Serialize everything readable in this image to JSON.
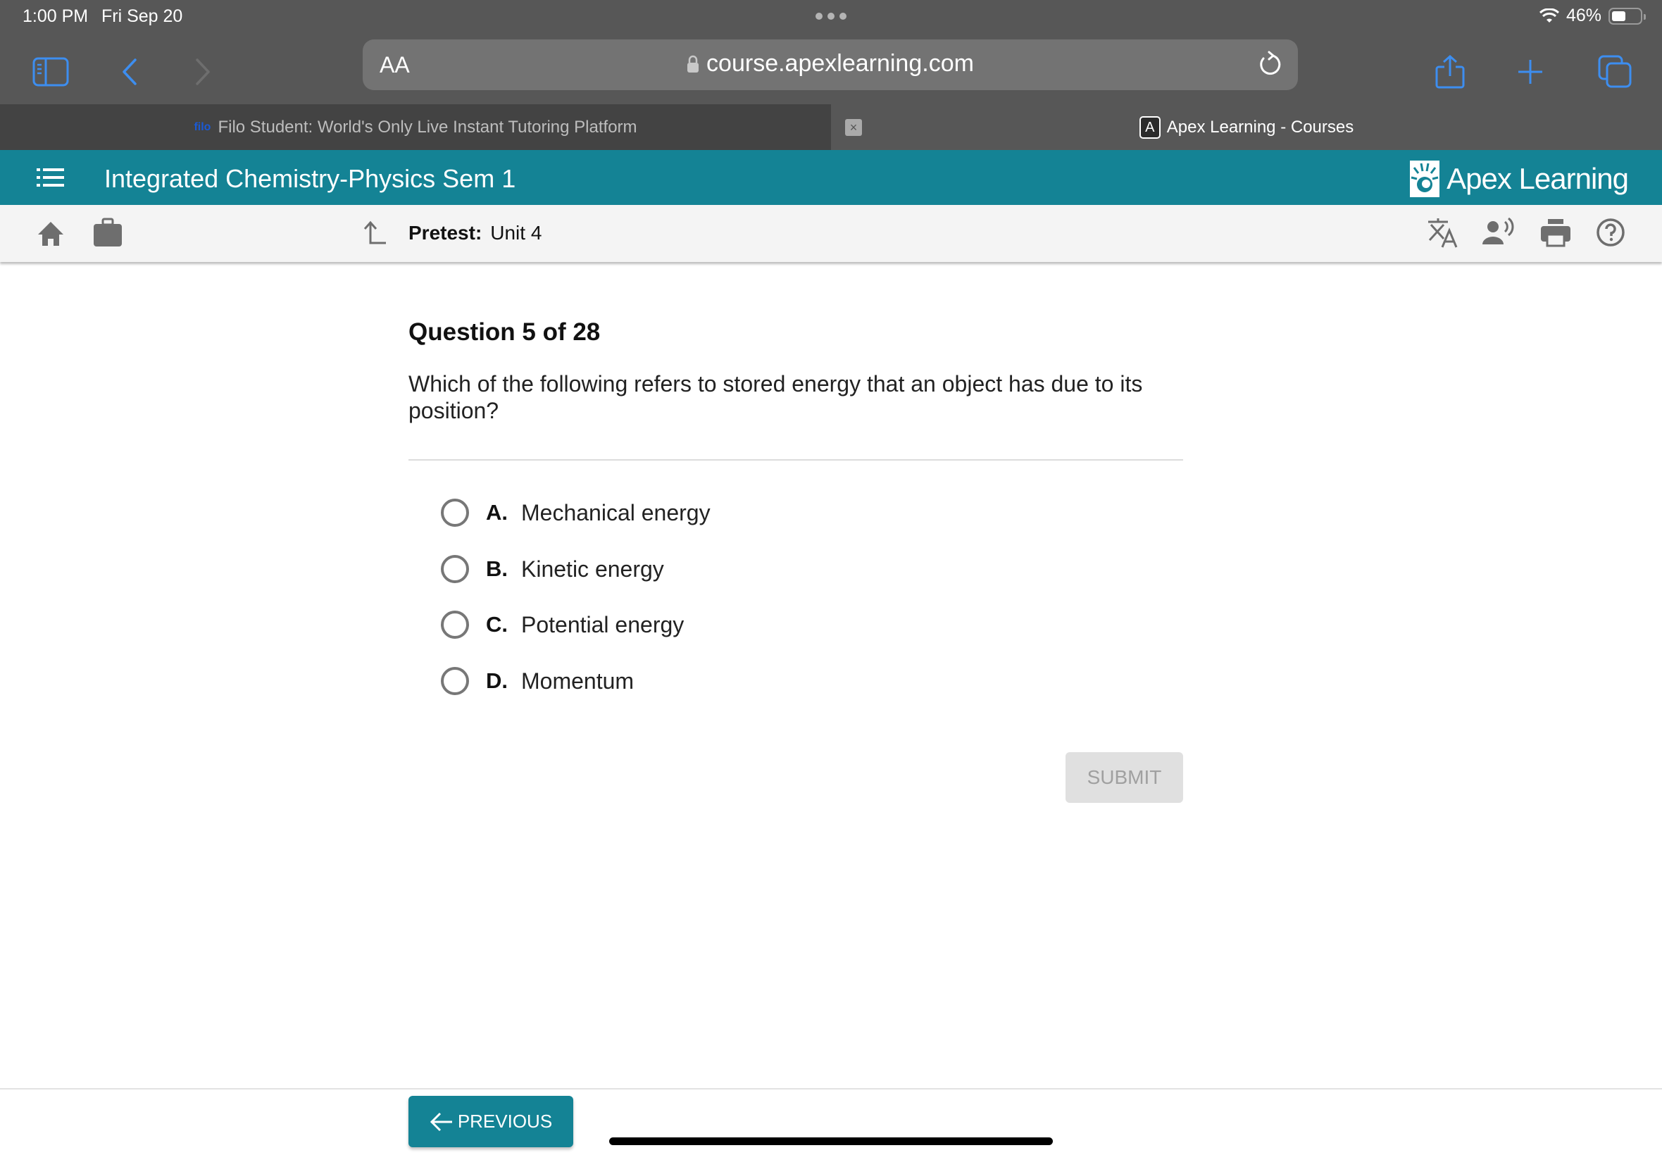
{
  "status_bar": {
    "time": "1:00 PM",
    "date": "Fri Sep 20",
    "battery_percent": "46%",
    "battery_level": 0.46
  },
  "browser": {
    "url_aa_label": "AA",
    "url": "course.apexlearning.com",
    "tabs": [
      {
        "favicon": "filo",
        "title": "Filo Student: World's Only Live Instant Tutoring Platform",
        "active": false
      },
      {
        "favicon": "A",
        "title": "Apex Learning - Courses",
        "active": true
      }
    ],
    "accent_color": "#3d8ef0"
  },
  "header": {
    "course_title": "Integrated Chemistry-Physics Sem 1",
    "brand": "Apex Learning",
    "brand_color": "#148395"
  },
  "breadcrumb": {
    "label": "Pretest:",
    "value": "Unit 4"
  },
  "question": {
    "title": "Question 5 of 28",
    "text": "Which of the following refers to stored energy that an object has due to its position?",
    "options": [
      {
        "letter": "A.",
        "text": "Mechanical energy"
      },
      {
        "letter": "B.",
        "text": "Kinetic energy"
      },
      {
        "letter": "C.",
        "text": "Potential energy"
      },
      {
        "letter": "D.",
        "text": "Momentum"
      }
    ]
  },
  "actions": {
    "submit_label": "SUBMIT",
    "previous_label": "PREVIOUS"
  }
}
